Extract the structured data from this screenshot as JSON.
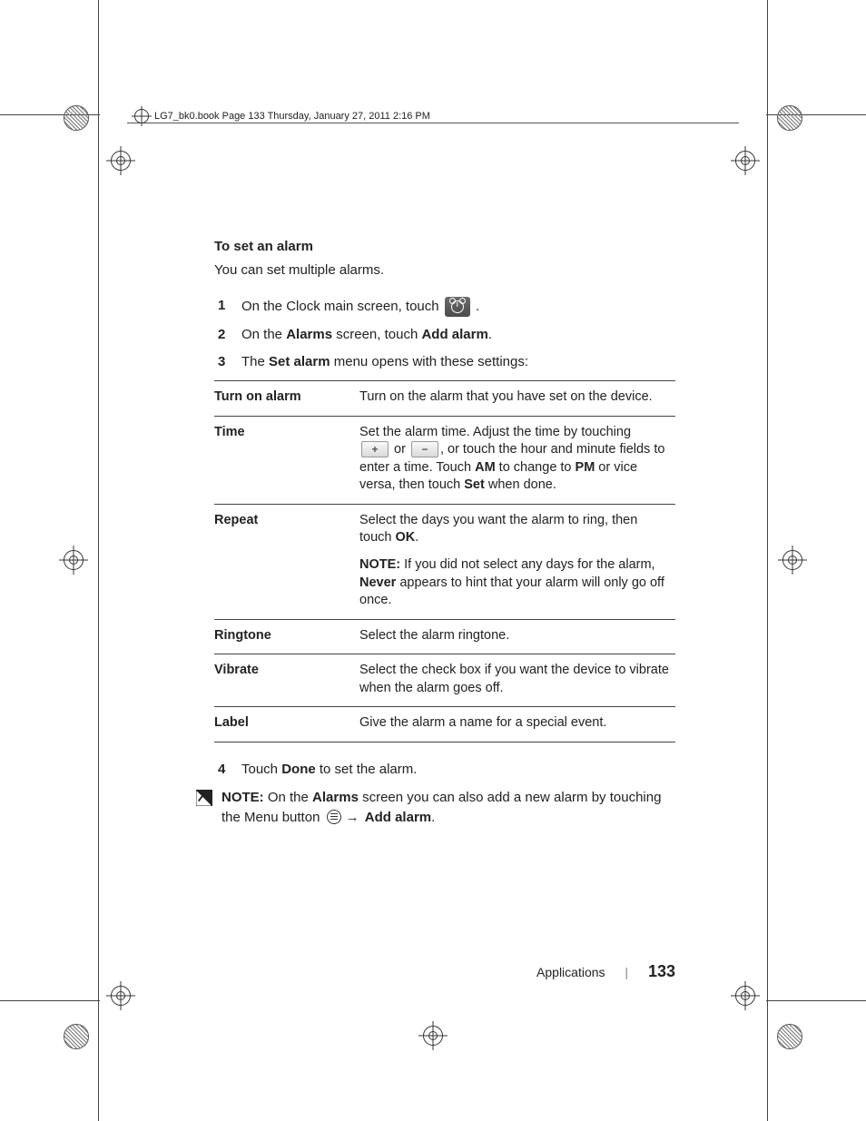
{
  "header_line": "LG7_bk0.book  Page 133  Thursday, January 27, 2011  2:16 PM",
  "section_title": "To set an alarm",
  "intro": "You can set multiple alarms.",
  "steps": {
    "s1_a": "On the Clock main screen, touch ",
    "s1_b": ".",
    "s2_a": "On the ",
    "s2_b": "Alarms",
    "s2_c": " screen, touch ",
    "s2_d": "Add alarm",
    "s2_e": ".",
    "s3_a": "The ",
    "s3_b": "Set alarm",
    "s3_c": " menu opens with these settings:",
    "s4_a": "Touch ",
    "s4_b": "Done",
    "s4_c": " to set the alarm."
  },
  "table": {
    "rows": [
      {
        "label": "Turn on alarm",
        "body_plain": "Turn on the alarm that you have set on the device."
      },
      {
        "label": "Time",
        "line1": "Set the alarm time. Adjust the time by touching",
        "line2_a": " or ",
        "line2_b": ", or touch the hour and minute fields to enter a time. Touch ",
        "line2_c": "AM",
        "line2_d": " to change to ",
        "line2_e": "PM",
        "line2_f": " or vice versa, then touch ",
        "line2_g": "Set",
        "line2_h": " when done."
      },
      {
        "label": "Repeat",
        "body_a": "Select the days you want the alarm to ring, then touch ",
        "body_b": "OK",
        "body_c": ".",
        "note_a": "NOTE:",
        "note_b": " If you did not select any days for the alarm, ",
        "note_c": "Never",
        "note_d": " appears to hint that your alarm will only go off once."
      },
      {
        "label": "Ringtone",
        "body_plain": "Select the alarm ringtone."
      },
      {
        "label": "Vibrate",
        "body_plain": "Select the check box if you want the device to vibrate when the alarm goes off."
      },
      {
        "label": "Label",
        "body_plain": "Give the alarm a name for a special event."
      }
    ]
  },
  "note": {
    "lead": "NOTE:",
    "a": " On the ",
    "b": "Alarms",
    "c": " screen you can also add a new alarm by touching the Menu button ",
    "d": "→ ",
    "e": "Add alarm",
    "f": "."
  },
  "footer": {
    "section": "Applications",
    "page": "133"
  },
  "icons": {
    "plus": "+",
    "minus": "−"
  }
}
